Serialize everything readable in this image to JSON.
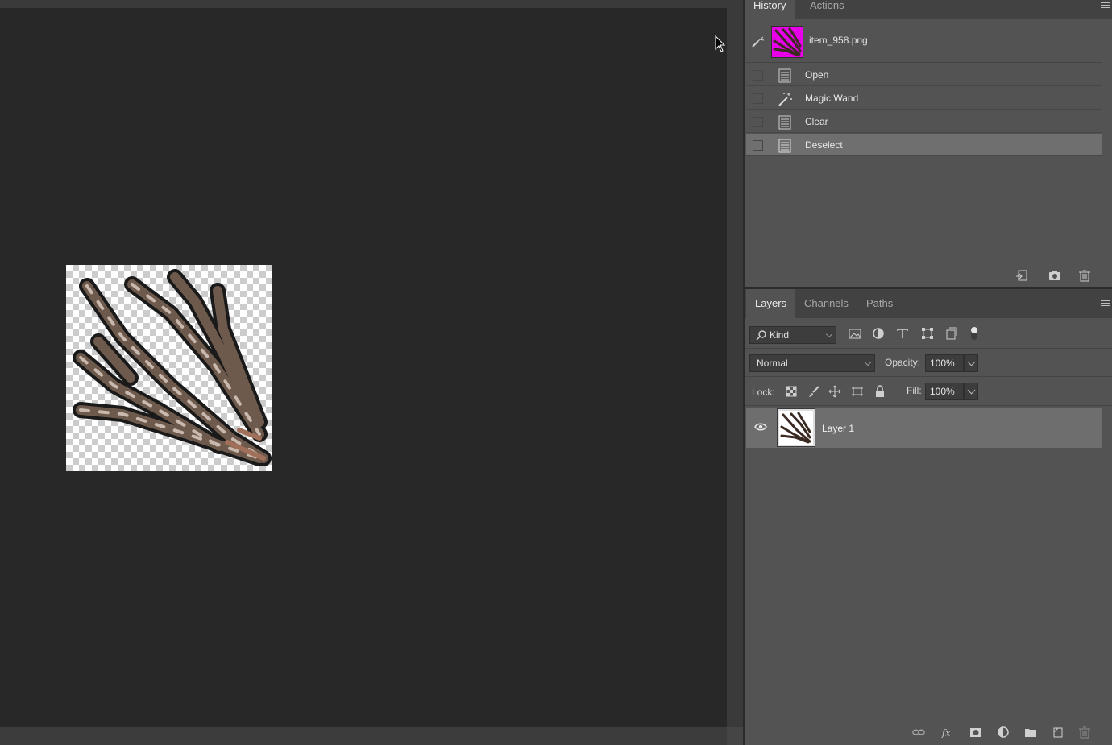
{
  "history_panel": {
    "tabs": [
      "History",
      "Actions"
    ],
    "snapshot": {
      "name": "item_958.png"
    },
    "steps": [
      {
        "label": "Open",
        "icon": "document-icon"
      },
      {
        "label": "Magic Wand",
        "icon": "magic-wand-icon"
      },
      {
        "label": "Clear",
        "icon": "document-icon"
      },
      {
        "label": "Deselect",
        "icon": "document-icon",
        "selected": true
      }
    ],
    "footer_icons": [
      "new-document-from-state-icon",
      "camera-icon",
      "trash-icon"
    ]
  },
  "layers_panel": {
    "tabs": [
      "Layers",
      "Channels",
      "Paths"
    ],
    "filter_kind": "Kind",
    "filter_icons": [
      "image-filter-icon",
      "adjustment-filter-icon",
      "type-filter-icon",
      "shape-filter-icon",
      "smart-object-filter-icon",
      "filter-toggle-icon"
    ],
    "blend_mode": "Normal",
    "opacity_label": "Opacity:",
    "opacity_value": "100%",
    "lock_label": "Lock:",
    "lock_icons": [
      "lock-transparent-icon",
      "lock-image-icon",
      "lock-position-icon",
      "lock-artboard-icon",
      "lock-all-icon"
    ],
    "fill_label": "Fill:",
    "fill_value": "100%",
    "layers": [
      {
        "name": "Layer 1",
        "visible": true
      }
    ],
    "footer_icons": [
      "link-icon",
      "fx-icon",
      "mask-icon",
      "adjustment-layer-icon",
      "group-folder-icon",
      "new-layer-icon",
      "trash-icon"
    ]
  },
  "colors": {
    "canvas_bg": "#282828",
    "panel_bg": "#535353",
    "selected_row": "#6f6f6f",
    "snapshot_thumb": "#e800e8"
  }
}
